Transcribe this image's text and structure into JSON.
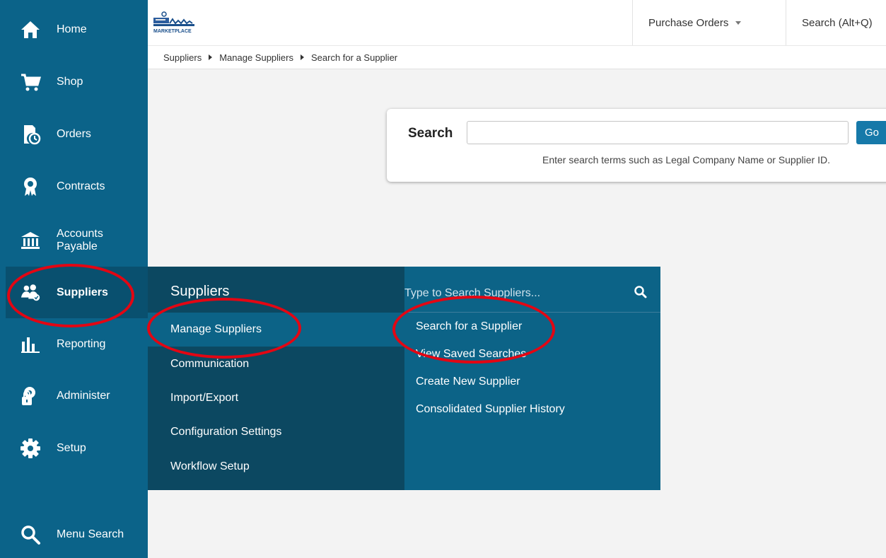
{
  "sidebar": {
    "items": [
      {
        "label": "Home",
        "icon": "home-icon"
      },
      {
        "label": "Shop",
        "icon": "cart-icon"
      },
      {
        "label": "Orders",
        "icon": "orders-icon"
      },
      {
        "label": "Contracts",
        "icon": "award-icon"
      },
      {
        "label": "Accounts\nPayable",
        "icon": "bank-icon"
      },
      {
        "label": "Suppliers",
        "icon": "users-icon"
      },
      {
        "label": "Reporting",
        "icon": "bar-chart-icon"
      },
      {
        "label": "Administer",
        "icon": "admin-icon"
      },
      {
        "label": "Setup",
        "icon": "gear-icon"
      },
      {
        "label": "Menu Search",
        "icon": "search-icon"
      }
    ]
  },
  "topbar": {
    "logo_text": "MARKETPLACE",
    "purchase_orders_label": "Purchase Orders",
    "search_label": "Search (Alt+Q)"
  },
  "breadcrumb": {
    "items": [
      "Suppliers",
      "Manage Suppliers",
      "Search for a Supplier"
    ]
  },
  "search_card": {
    "label": "Search",
    "input_value": "",
    "go_label": "Go",
    "hint": "Enter search terms such as Legal Company Name or Supplier ID."
  },
  "flyout": {
    "title": "Suppliers",
    "items": [
      "Manage Suppliers",
      "Communication",
      "Import/Export",
      "Configuration Settings",
      "Workflow Setup"
    ],
    "search_placeholder": "Type to Search Suppliers...",
    "sub_items": [
      "Search for a Supplier",
      "View Saved Searches",
      "Create New Supplier",
      "Consolidated Supplier History"
    ]
  },
  "colors": {
    "sidebar": "#0b6389",
    "sidebar_active": "#09506f",
    "flyout_dark": "#0c4861",
    "flyout_light": "#0c6387",
    "annotation": "#e30613",
    "go_button": "#1679a9"
  }
}
